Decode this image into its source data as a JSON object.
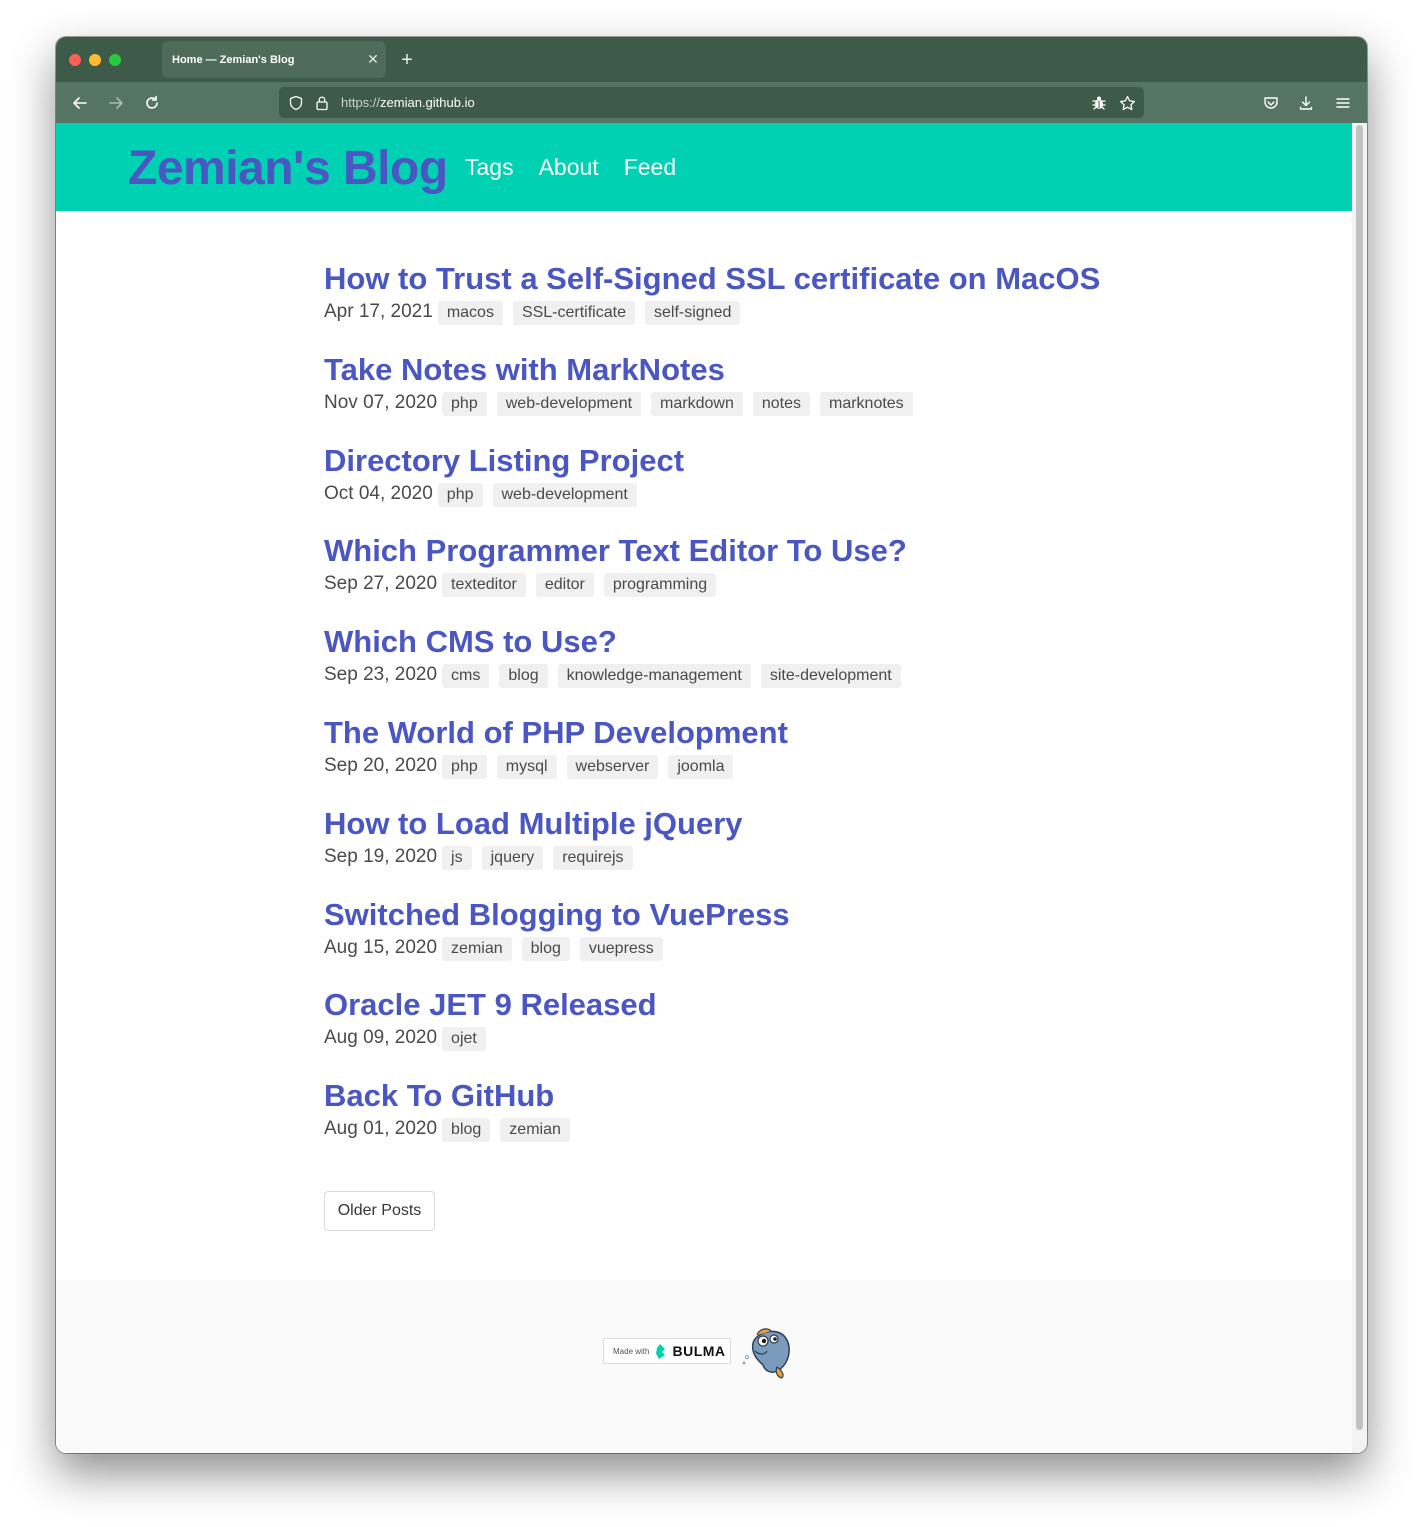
{
  "browser": {
    "tab_title": "Home — Zemian's Blog",
    "tab_close": "✕",
    "new_tab": "+",
    "url_protocol": "https://",
    "url_host": "zemian.github.io"
  },
  "site": {
    "brand": "Zemian's Blog",
    "nav": [
      "Tags",
      "About",
      "Feed"
    ]
  },
  "posts": [
    {
      "title": "How to Trust a Self-Signed SSL certificate on MacOS",
      "date": "Apr 17, 2021",
      "tags": [
        "macos",
        "SSL-certificate",
        "self-signed"
      ]
    },
    {
      "title": "Take Notes with MarkNotes",
      "date": "Nov 07, 2020",
      "tags": [
        "php",
        "web-development",
        "markdown",
        "notes",
        "marknotes"
      ]
    },
    {
      "title": "Directory Listing Project",
      "date": "Oct 04, 2020",
      "tags": [
        "php",
        "web-development"
      ]
    },
    {
      "title": "Which Programmer Text Editor To Use?",
      "date": "Sep 27, 2020",
      "tags": [
        "texteditor",
        "editor",
        "programming"
      ]
    },
    {
      "title": "Which CMS to Use?",
      "date": "Sep 23, 2020",
      "tags": [
        "cms",
        "blog",
        "knowledge-management",
        "site-development"
      ]
    },
    {
      "title": "The World of PHP Development",
      "date": "Sep 20, 2020",
      "tags": [
        "php",
        "mysql",
        "webserver",
        "joomla"
      ]
    },
    {
      "title": "How to Load Multiple jQuery",
      "date": "Sep 19, 2020",
      "tags": [
        "js",
        "jquery",
        "requirejs"
      ]
    },
    {
      "title": "Switched Blogging to VuePress",
      "date": "Aug 15, 2020",
      "tags": [
        "zemian",
        "blog",
        "vuepress"
      ]
    },
    {
      "title": "Oracle JET 9 Released",
      "date": "Aug 09, 2020",
      "tags": [
        "ojet"
      ]
    },
    {
      "title": "Back To GitHub",
      "date": "Aug 01, 2020",
      "tags": [
        "blog",
        "zemian"
      ]
    }
  ],
  "pagination": {
    "older_label": "Older Posts"
  },
  "footer": {
    "made_with": "Made with",
    "bulma": "BULMA"
  },
  "colors": {
    "header_bg": "#00d1b2",
    "brand": "#4a56c2",
    "title": "#4a56c2",
    "tag_bg": "#f0f0f0",
    "chrome_dark": "#3e5a48",
    "chrome_light": "#557463"
  }
}
